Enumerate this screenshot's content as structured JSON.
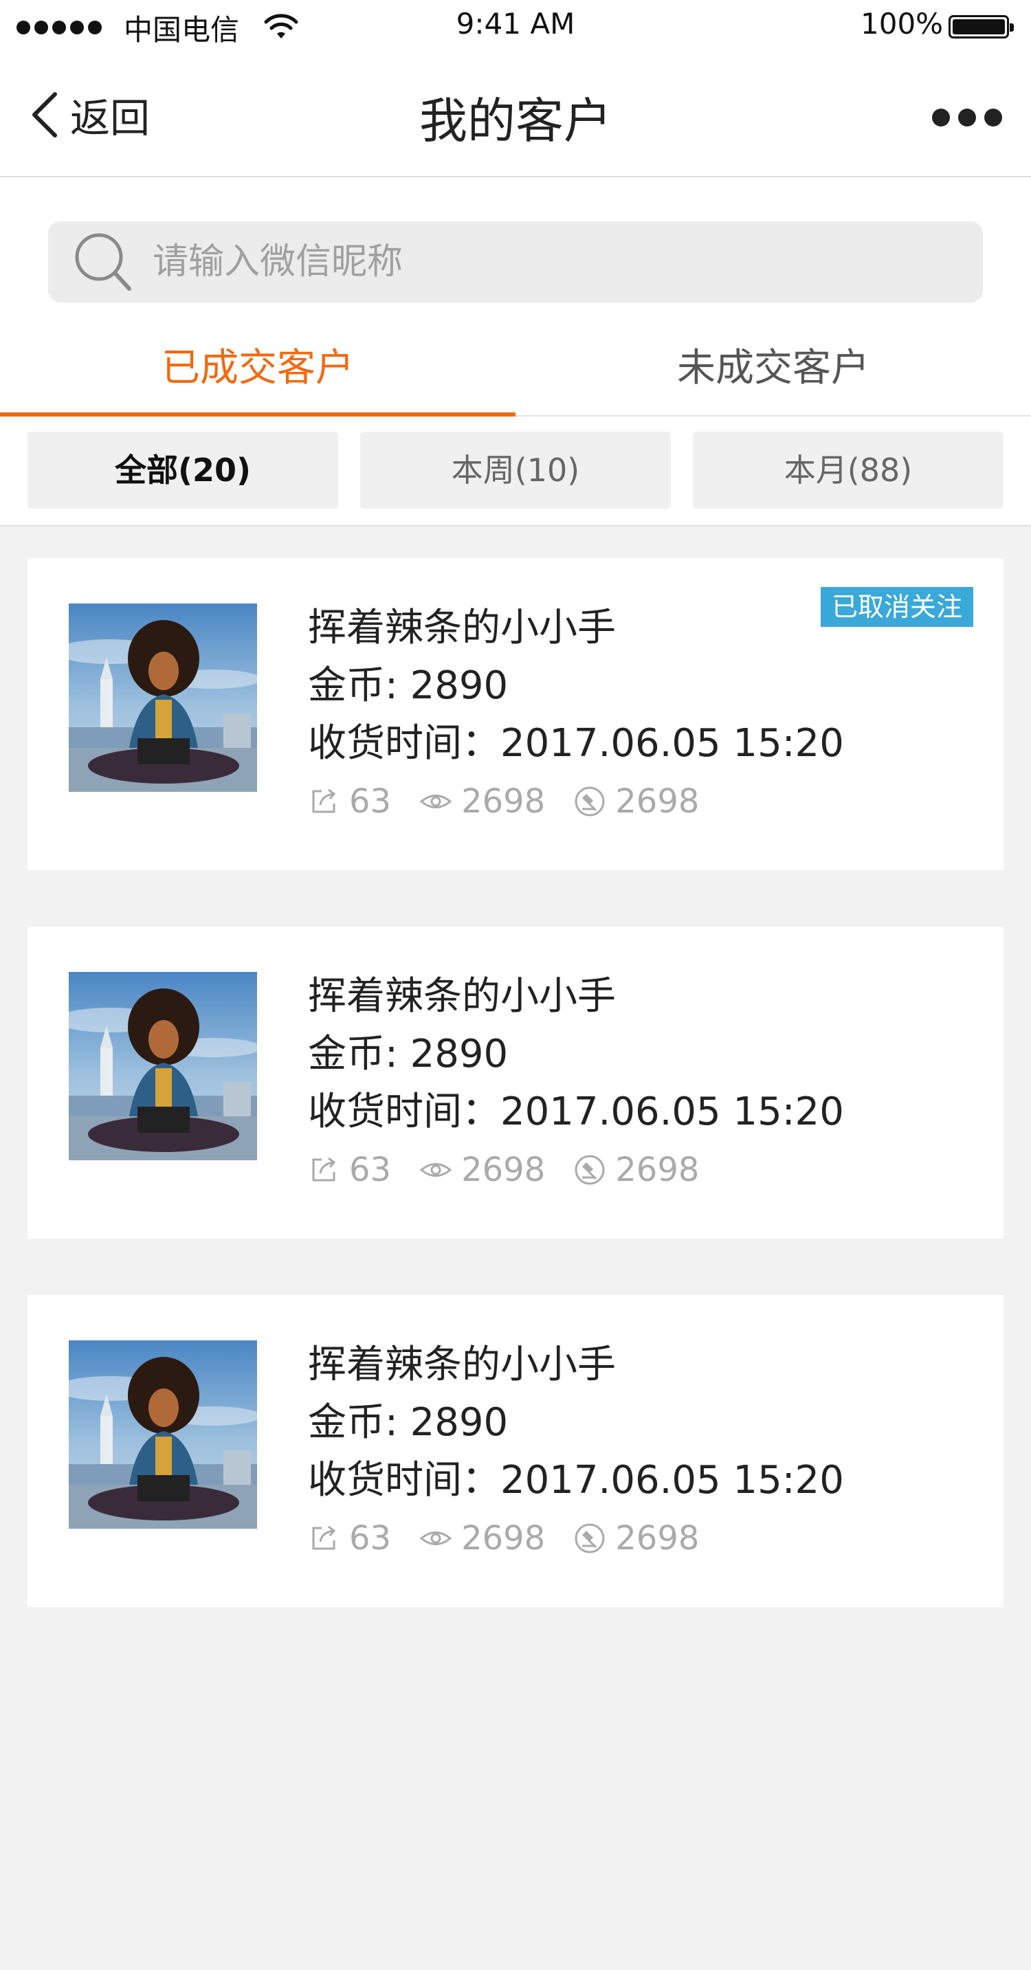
{
  "status_bar": {
    "carrier": "中国电信",
    "time": "9:41 AM",
    "battery": "100%"
  },
  "nav": {
    "back_label": "返回",
    "title": "我的客户"
  },
  "search": {
    "placeholder": "请输入微信昵称"
  },
  "tabs": [
    {
      "label": "已成交客户",
      "active": true
    },
    {
      "label": "未成交客户",
      "active": false
    }
  ],
  "filters": [
    {
      "label": "全部(20)",
      "active": true
    },
    {
      "label": "本周(10)",
      "active": false
    },
    {
      "label": "本月(88)",
      "active": false
    }
  ],
  "customers": [
    {
      "name": "挥着辣条的小小手",
      "coins": "金币: 2890",
      "receipt_time": "收货时间：2017.06.05 15:20",
      "shares": "63",
      "views": "2698",
      "deals": "2698",
      "badge": "已取消关注"
    },
    {
      "name": "挥着辣条的小小手",
      "coins": "金币: 2890",
      "receipt_time": "收货时间：2017.06.05 15:20",
      "shares": "63",
      "views": "2698",
      "deals": "2698"
    },
    {
      "name": "挥着辣条的小小手",
      "coins": "金币: 2890",
      "receipt_time": "收货时间：2017.06.05 15:20",
      "shares": "63",
      "views": "2698",
      "deals": "2698"
    }
  ],
  "colors": {
    "accent": "#f06a12",
    "badge": "#3aa8d8",
    "background": "#f2f2f2"
  },
  "icons": {
    "share": "share-icon",
    "views": "eye-icon",
    "deals": "hammer-icon"
  }
}
